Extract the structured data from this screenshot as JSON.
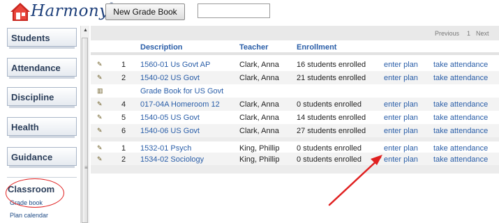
{
  "app": {
    "brand": "Harmony",
    "reg_mark": "®",
    "new_gradebook_label": "New Grade Book",
    "search_value": "",
    "search_placeholder": ""
  },
  "sidebar": {
    "items": [
      {
        "label": "Students"
      },
      {
        "label": "Attendance"
      },
      {
        "label": "Discipline"
      },
      {
        "label": "Health"
      },
      {
        "label": "Guidance"
      }
    ],
    "classroom": {
      "label": "Classroom",
      "links": [
        "Grade book",
        "Plan calendar"
      ]
    }
  },
  "pager": {
    "previous": "Previous",
    "page": "1",
    "next": "Next"
  },
  "table": {
    "columns": {
      "description": "Description",
      "teacher": "Teacher",
      "enrollment": "Enrollment"
    },
    "rows": [
      {
        "num": "1",
        "desc": "1560-01 Us Govt AP",
        "teacher": "Clark, Anna",
        "enroll": "16 students enrolled",
        "plan": "enter plan",
        "att": "take attendance",
        "icon": "edit-icon"
      },
      {
        "num": "2",
        "desc": "1540-02 US Govt",
        "teacher": "Clark, Anna",
        "enroll": "21 students enrolled",
        "plan": "enter plan",
        "att": "take attendance",
        "icon": "edit-icon"
      },
      {
        "num": "",
        "desc": "Grade Book for US Govt",
        "teacher": "",
        "enroll": "",
        "plan": "",
        "att": "",
        "icon": "book-icon"
      },
      {
        "num": "4",
        "desc": "017-04A Homeroom 12",
        "teacher": "Clark, Anna",
        "enroll": "0 students enrolled",
        "plan": "enter plan",
        "att": "take attendance",
        "icon": "edit-icon"
      },
      {
        "num": "5",
        "desc": "1540-05 US Govt",
        "teacher": "Clark, Anna",
        "enroll": "14 students enrolled",
        "plan": "enter plan",
        "att": "take attendance",
        "icon": "edit-icon"
      },
      {
        "num": "6",
        "desc": "1540-06 US Govt",
        "teacher": "Clark, Anna",
        "enroll": "27 students enrolled",
        "plan": "enter plan",
        "att": "take attendance",
        "icon": "edit-icon"
      },
      {
        "num": "1",
        "desc": "1532-01 Psych",
        "teacher": "King, Phillip",
        "enroll": "0 students enrolled",
        "plan": "enter plan",
        "att": "take attendance",
        "icon": "edit-icon"
      },
      {
        "num": "2",
        "desc": "1534-02 Sociology",
        "teacher": "King, Phillip",
        "enroll": "0 students enrolled",
        "plan": "enter plan",
        "att": "take attendance",
        "icon": "edit-icon"
      }
    ]
  },
  "colors": {
    "link": "#2a5ea8",
    "annotation": "#e02020",
    "brand": "#1d3f7a"
  }
}
